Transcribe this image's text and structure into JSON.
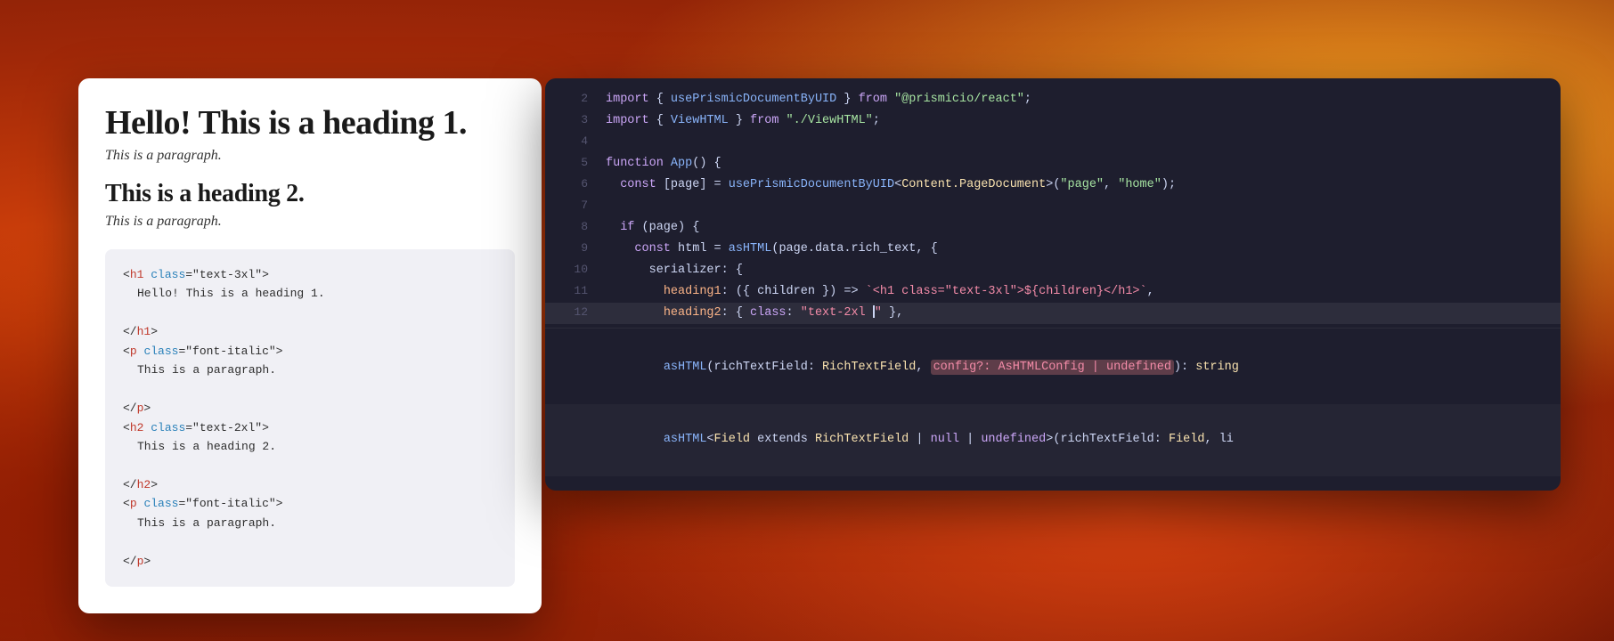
{
  "background": {
    "type": "macos-gradient"
  },
  "left_panel": {
    "heading1": "Hello! This is a heading 1.",
    "paragraph1": "This is a paragraph.",
    "heading2": "This is a heading 2.",
    "paragraph2": "This is a paragraph.",
    "code_lines": [
      {
        "indent": 0,
        "content": "<h1 class=\"text-3xl\">"
      },
      {
        "indent": 1,
        "content": "Hello! This is a heading 1."
      },
      {
        "indent": 0,
        "content": "</h1>"
      },
      {
        "indent": 0,
        "content": "<p class=\"font-italic\">"
      },
      {
        "indent": 1,
        "content": "This is a paragraph."
      },
      {
        "indent": 0,
        "content": "</p>"
      },
      {
        "indent": 0,
        "content": "<h2 class=\"text-2xl\">"
      },
      {
        "indent": 1,
        "content": "This is a heading 2."
      },
      {
        "indent": 0,
        "content": "</h2>"
      },
      {
        "indent": 0,
        "content": "<p class=\"font-italic\">"
      },
      {
        "indent": 1,
        "content": "This is a paragraph."
      },
      {
        "indent": 0,
        "content": "</p>"
      }
    ]
  },
  "right_panel": {
    "lines": [
      {
        "num": 2,
        "highlighted": false,
        "parts": [
          {
            "type": "kw",
            "text": "import"
          },
          {
            "type": "var",
            "text": " { "
          },
          {
            "type": "fn",
            "text": "usePrismicDocumentByUID"
          },
          {
            "type": "var",
            "text": " } "
          },
          {
            "type": "kw",
            "text": "from"
          },
          {
            "type": "str",
            "text": " \"@prismicio/react\""
          },
          {
            "type": "punct",
            "text": ";"
          }
        ]
      },
      {
        "num": 3,
        "highlighted": false,
        "parts": [
          {
            "type": "kw",
            "text": "import"
          },
          {
            "type": "var",
            "text": " { "
          },
          {
            "type": "fn",
            "text": "ViewHTML"
          },
          {
            "type": "var",
            "text": " } "
          },
          {
            "type": "kw",
            "text": "from"
          },
          {
            "type": "str",
            "text": " \"./ViewHTML\""
          },
          {
            "type": "punct",
            "text": ";"
          }
        ]
      },
      {
        "num": 4,
        "highlighted": false,
        "parts": []
      },
      {
        "num": 5,
        "highlighted": false,
        "parts": [
          {
            "type": "kw",
            "text": "function"
          },
          {
            "type": "fn",
            "text": " App"
          },
          {
            "type": "punct",
            "text": "() {"
          }
        ]
      },
      {
        "num": 6,
        "highlighted": false,
        "parts": [
          {
            "type": "var",
            "text": "  "
          },
          {
            "type": "kw",
            "text": "const"
          },
          {
            "type": "var",
            "text": " [page] = "
          },
          {
            "type": "fn",
            "text": "usePrismicDocumentByUID"
          },
          {
            "type": "punct",
            "text": "<"
          },
          {
            "type": "type",
            "text": "Content.PageDocument"
          },
          {
            "type": "punct",
            "text": ">"
          },
          {
            "type": "punct",
            "text": "("
          },
          {
            "type": "str",
            "text": "\"page\""
          },
          {
            "type": "punct",
            "text": ", "
          },
          {
            "type": "str",
            "text": "\"home\""
          },
          {
            "type": "punct",
            "text": ");"
          }
        ]
      },
      {
        "num": 7,
        "highlighted": false,
        "parts": []
      },
      {
        "num": 8,
        "highlighted": false,
        "parts": [
          {
            "type": "var",
            "text": "  "
          },
          {
            "type": "kw",
            "text": "if"
          },
          {
            "type": "punct",
            "text": " (page) {"
          }
        ]
      },
      {
        "num": 9,
        "highlighted": false,
        "parts": [
          {
            "type": "var",
            "text": "    "
          },
          {
            "type": "kw",
            "text": "const"
          },
          {
            "type": "var",
            "text": " html = "
          },
          {
            "type": "fn",
            "text": "asHTML"
          },
          {
            "type": "punct",
            "text": "(page.data.rich_text, {"
          }
        ]
      },
      {
        "num": 10,
        "highlighted": false,
        "parts": [
          {
            "type": "var",
            "text": "      serializer: {"
          }
        ]
      },
      {
        "num": 11,
        "highlighted": false,
        "parts": [
          {
            "type": "var",
            "text": "        "
          },
          {
            "type": "prop",
            "text": "heading1"
          },
          {
            "type": "punct",
            "text": ": ("
          },
          {
            "type": "punct",
            "text": "{ "
          },
          {
            "type": "var",
            "text": "children"
          },
          {
            "type": "punct",
            "text": " }) => "
          },
          {
            "type": "str2",
            "text": "`<h1 class=\"text-3xl\">${children}</h1>`"
          },
          {
            "type": "punct",
            "text": ","
          }
        ]
      },
      {
        "num": 12,
        "highlighted": true,
        "parts": [
          {
            "type": "var",
            "text": "        "
          },
          {
            "type": "prop",
            "text": "heading2"
          },
          {
            "type": "punct",
            "text": ": { "
          },
          {
            "type": "kw",
            "text": "class"
          },
          {
            "type": "punct",
            "text": ": "
          },
          {
            "type": "str2",
            "text": "\"text-2xl "
          },
          {
            "type": "cursor",
            "text": ""
          },
          {
            "type": "punct",
            "text": "\" },"
          }
        ]
      }
    ],
    "signature1": {
      "prefix": "asHTML(richTextField: RichTextField, ",
      "highlight": "config?: AsHTMLConfig | undefined",
      "suffix": "): string"
    },
    "signature2": "asHTML<Field extends RichTextField | null | undefined>(richTextField: Field, li"
  }
}
